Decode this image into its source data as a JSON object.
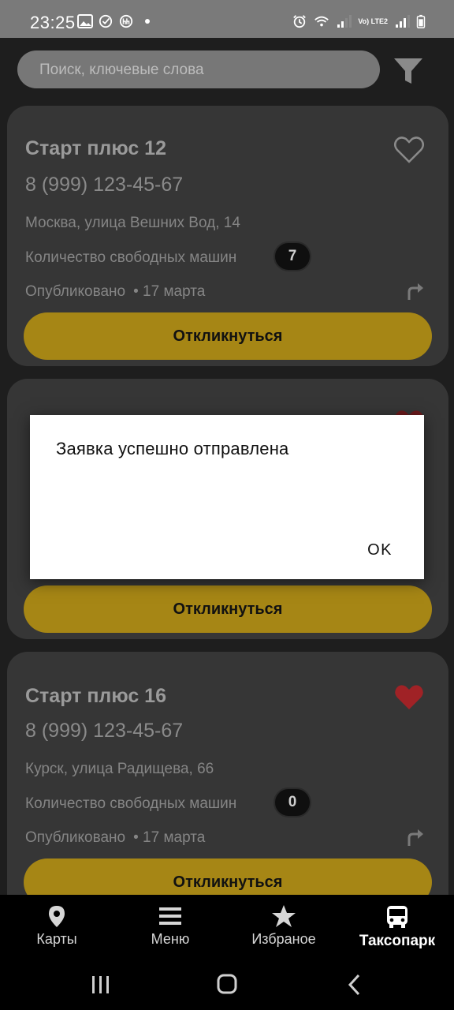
{
  "status_bar": {
    "time": "23:25",
    "network_label": "Vo) LTE2"
  },
  "search": {
    "placeholder": "Поиск, ключевые слова"
  },
  "cards": [
    {
      "title": "Старт плюс 12",
      "phone": "8 (999) 123-45-67",
      "address": "Москва, улица Вешних Вод, 14",
      "count_label": "Количество свободных машин",
      "count": "7",
      "published_label": "Опубликовано",
      "date": "• 17 марта",
      "favorite": false,
      "button": "Откликнуться"
    },
    {
      "button": "Откликнуться",
      "favorite": true
    },
    {
      "title": "Старт плюс 16",
      "phone": "8 (999) 123-45-67",
      "address": "Курск, улица Радищева, 66",
      "count_label": "Количество свободных машин",
      "count": "0",
      "published_label": "Опубликовано",
      "date": "• 17 марта",
      "favorite": true,
      "button": "Откликнуться"
    }
  ],
  "bottom_nav": {
    "items": [
      {
        "label": "Карты",
        "icon": "map-pin-icon"
      },
      {
        "label": "Меню",
        "icon": "menu-icon"
      },
      {
        "label": "Избраное",
        "icon": "star-icon"
      },
      {
        "label": "Таксопарк",
        "icon": "bus-icon",
        "active": true
      }
    ]
  },
  "dialog": {
    "message": "Заявка успешно отправлена",
    "ok_label": "OK"
  },
  "colors": {
    "accent": "#a68615",
    "heart_active": "#c0262a",
    "card_bg": "#363636"
  }
}
